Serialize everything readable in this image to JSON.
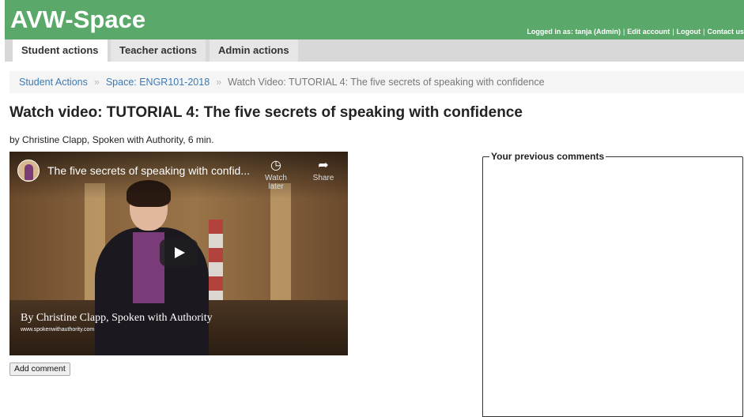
{
  "app": {
    "title": "AVW-Space"
  },
  "userbar": {
    "logged_in": "Logged in as: tanja (Admin)",
    "edit_account": "Edit account",
    "logout": "Logout",
    "contact": "Contact us"
  },
  "tabs": [
    {
      "label": "Student actions",
      "active": true
    },
    {
      "label": "Teacher actions",
      "active": false
    },
    {
      "label": "Admin actions",
      "active": false
    }
  ],
  "breadcrumb": {
    "items": [
      "Student Actions",
      "Space: ENGR101-2018",
      "Watch Video: TUTORIAL 4: The five secrets of speaking with confidence"
    ],
    "separator": "»"
  },
  "page": {
    "title": "Watch video: TUTORIAL 4: The five secrets of speaking with confidence",
    "byline": "by Christine Clapp, Spoken with Authority, 6 min."
  },
  "video": {
    "title": "The five secrets of speaking with confid...",
    "watch_later": "Watch later",
    "share": "Share",
    "caption": "By Christine Clapp, Spoken with Authority",
    "caption_url": "www.spokenwithauthority.com"
  },
  "add_comment_label": "Add comment",
  "comments": {
    "legend": "Your previous comments"
  },
  "colors": {
    "header": "#5aa86a",
    "link": "#3a7ab8",
    "tabbar": "#d8d8d8"
  }
}
